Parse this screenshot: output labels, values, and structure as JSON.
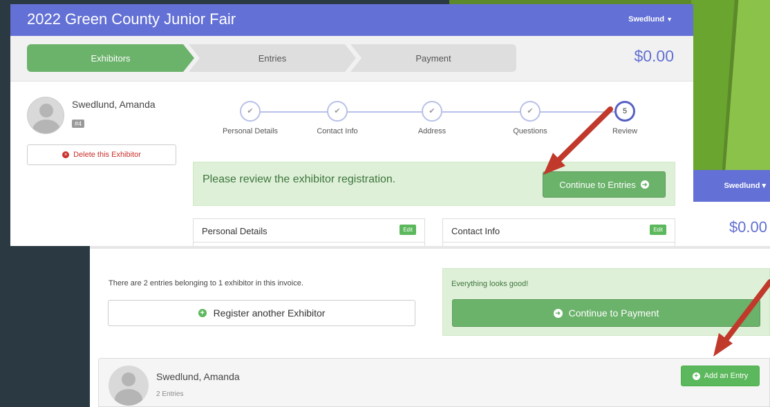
{
  "top_window": {
    "app_title": "2022 Green County Junior Fair",
    "user_menu": "Swedlund",
    "steps": [
      "Exhibitors",
      "Entries",
      "Payment"
    ],
    "total": "$0.00",
    "exhibitor": {
      "name": "Swedlund, Amanda",
      "number": "#4"
    },
    "delete_label": "Delete this Exhibitor",
    "wizard": [
      {
        "label": "Personal Details",
        "mark": "✔"
      },
      {
        "label": "Contact Info",
        "mark": "✔"
      },
      {
        "label": "Address",
        "mark": "✔"
      },
      {
        "label": "Questions",
        "mark": "✔"
      },
      {
        "label": "Review",
        "mark": "5"
      }
    ],
    "review_message": "Please review the exhibitor registration.",
    "continue_entries_label": "Continue to Entries",
    "panels": [
      {
        "title": "Personal Details",
        "edit": "Edit"
      },
      {
        "title": "Contact Info",
        "edit": "Edit"
      }
    ]
  },
  "background_window": {
    "user_menu": "Swedlund",
    "total": "$0.00"
  },
  "bottom_window": {
    "invoice_text": "There are 2 entries belonging to 1 exhibitor in this invoice.",
    "register_label": "Register another Exhibitor",
    "status_text": "Everything looks good!",
    "continue_payment_label": "Continue to Payment",
    "exhibitor": {
      "name": "Swedlund, Amanda",
      "entries": "2 Entries"
    },
    "add_entry_label": "Add an Entry"
  },
  "colors": {
    "header": "#6370d5",
    "success": "#6bb26b",
    "annotation_arrow": "#c0392b"
  }
}
